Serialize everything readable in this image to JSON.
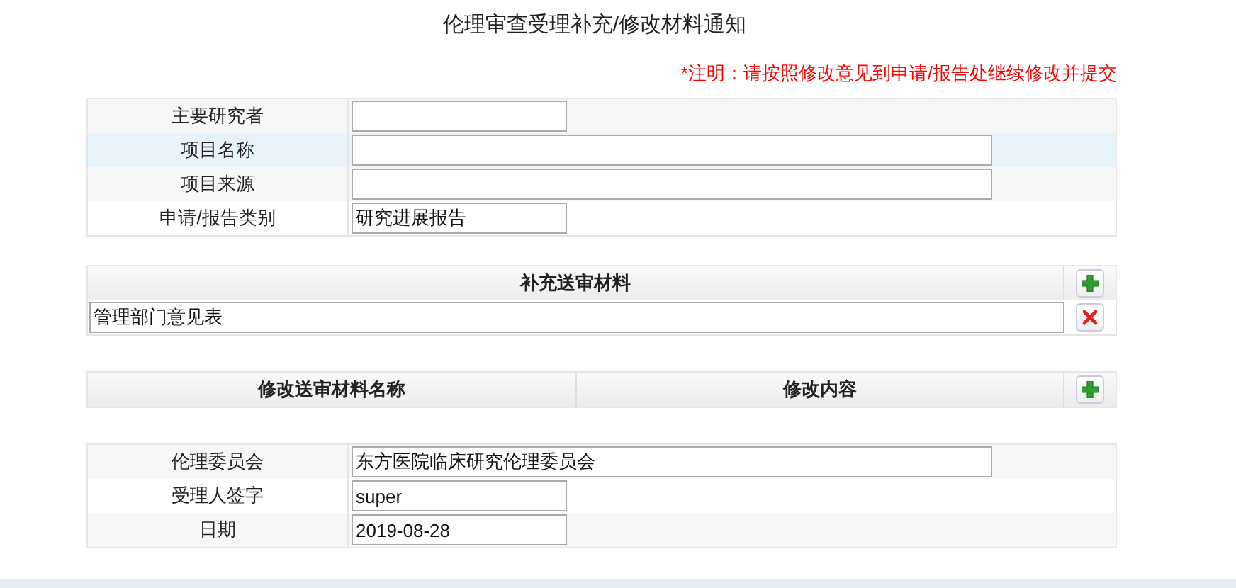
{
  "title": "伦理审查受理补充/修改材料通知",
  "note": "*注明：请按照修改意见到申请/报告处继续修改并提交",
  "info_rows": [
    {
      "label": "主要研究者",
      "kind": "short",
      "value": "",
      "selected": false
    },
    {
      "label": "项目名称",
      "kind": "long",
      "value": "",
      "selected": true
    },
    {
      "label": "项目来源",
      "kind": "long",
      "value": "",
      "selected": false
    },
    {
      "label": "申请/报告类别",
      "kind": "short",
      "value": "研究进展报告",
      "selected": false
    }
  ],
  "supplement": {
    "columns": [
      "补充送审材料"
    ],
    "rows": [
      {
        "value": "管理部门意见表"
      }
    ]
  },
  "modify": {
    "columns": [
      "修改送审材料名称",
      "修改内容"
    ]
  },
  "sign_rows": [
    {
      "label": "伦理委员会",
      "kind": "long",
      "value": "东方医院临床研究伦理委员会",
      "selected": false
    },
    {
      "label": "受理人签字",
      "kind": "short",
      "value": "super",
      "selected": false
    },
    {
      "label": "日期",
      "kind": "short",
      "value": "2019-08-28",
      "selected": false
    }
  ]
}
